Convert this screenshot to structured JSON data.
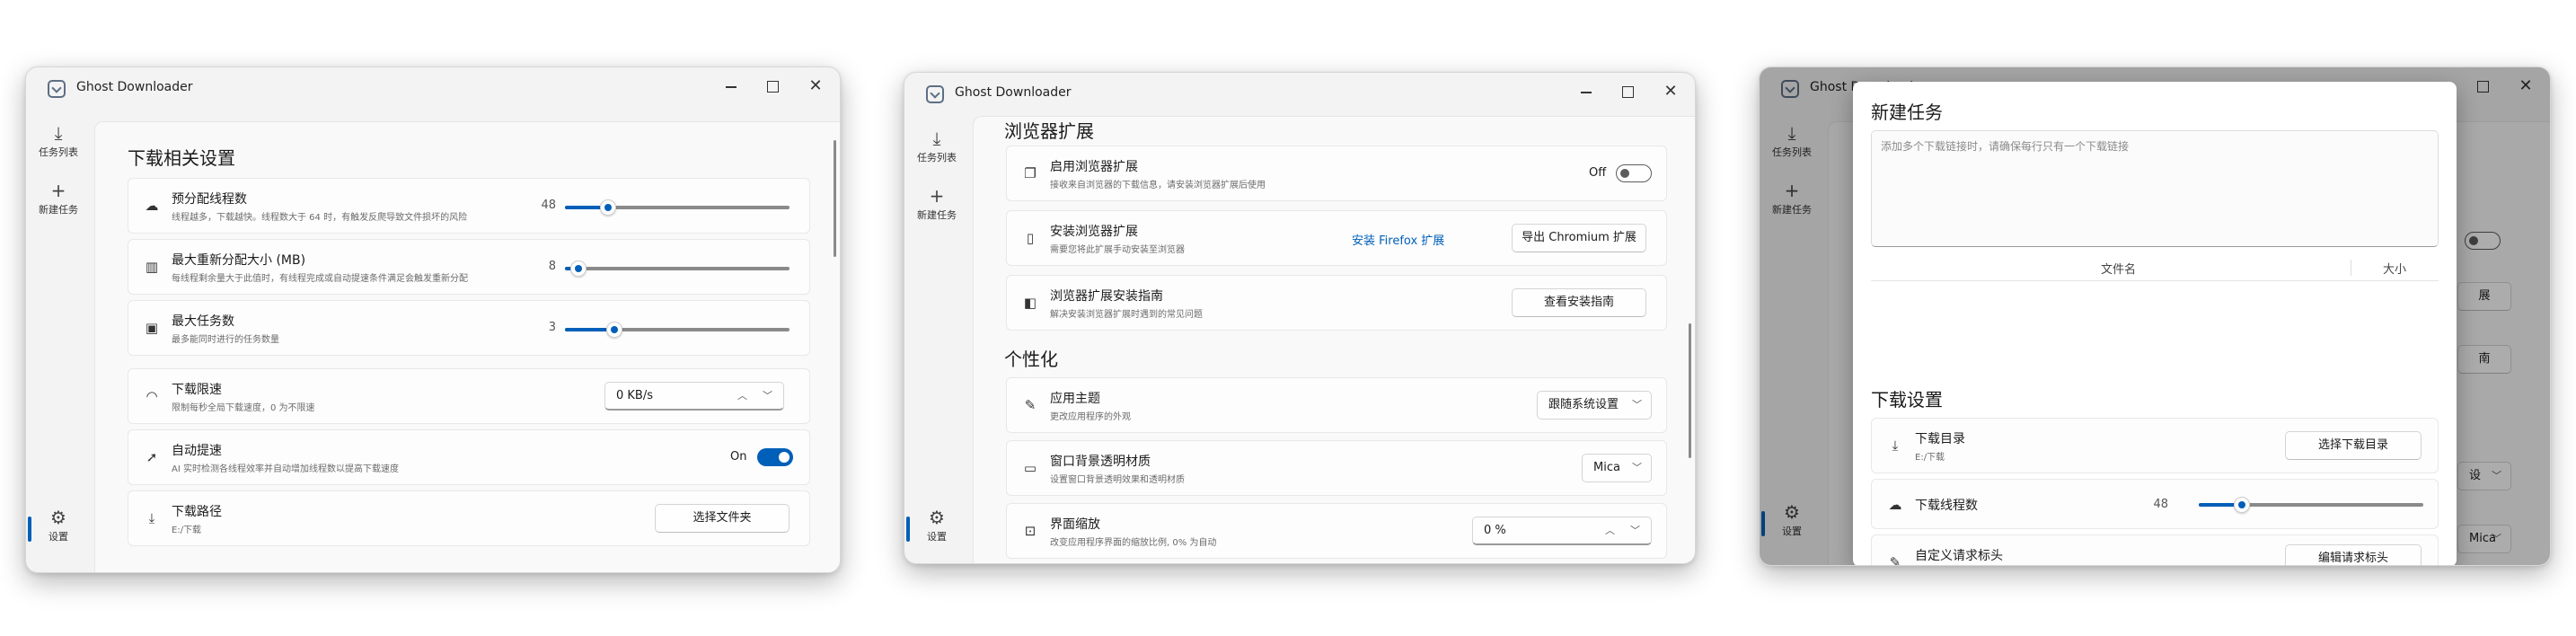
{
  "app_title": "Ghost Downloader",
  "nav": {
    "task_list": "任务列表",
    "new_task": "新建任务",
    "settings": "设置"
  },
  "window1": {
    "section_title": "下载相关设置",
    "preallocate": {
      "title": "预分配线程数",
      "subtitle": "线程越多，下载越快。线程数大于 64 时，有触发反爬导致文件损坏的风险",
      "value": "48",
      "level": 0.19
    },
    "max_realloc": {
      "title": "最大重新分配大小 (MB)",
      "subtitle": "每线程剩余量大于此值时，有线程完成或自动提速条件满足会触发重新分配",
      "value": "8",
      "level": 0.06
    },
    "max_tasks": {
      "title": "最大任务数",
      "subtitle": "最多能同时进行的任务数量",
      "value": "3",
      "level": 0.22
    },
    "speed_limit": {
      "title": "下载限速",
      "subtitle": "限制每秒全局下载速度，0 为不限速",
      "value": "0 KB/s"
    },
    "auto_speedup": {
      "title": "自动提速",
      "subtitle": "AI 实时检测各线程效率并自动增加线程数以提高下载速度",
      "state": "On"
    },
    "download_path": {
      "title": "下载路径",
      "subtitle": "E:/下载",
      "button": "选择文件夹"
    }
  },
  "window2": {
    "section_browser": "浏览器扩展",
    "enable_ext": {
      "title": "启用浏览器扩展",
      "subtitle": "接收来自浏览器的下载信息，请安装浏览器扩展后使用",
      "state": "Off"
    },
    "install_ext": {
      "title": "安装浏览器扩展",
      "subtitle": "需要您将此扩展手动安装至浏览器",
      "link": "安装 Firefox 扩展",
      "button": "导出 Chromium 扩展"
    },
    "install_guide": {
      "title": "浏览器扩展安装指南",
      "subtitle": "解决安装浏览器扩展时遇到的常见问题",
      "button": "查看安装指南"
    },
    "section_personal": "个性化",
    "theme": {
      "title": "应用主题",
      "subtitle": "更改应用程序的外观",
      "value": "跟随系统设置"
    },
    "backdrop": {
      "title": "窗口背景透明材质",
      "subtitle": "设置窗口背景透明效果和透明材质",
      "value": "Mica"
    },
    "scale": {
      "title": "界面缩放",
      "subtitle": "改变应用程序界面的缩放比例, 0% 为自动",
      "value": "0 %"
    }
  },
  "window3": {
    "dialog_title": "新建任务",
    "url_placeholder": "添加多个下载链接时，请确保每行只有一个下载链接",
    "col_filename": "文件名",
    "col_size": "大小",
    "section_download": "下载设置",
    "download_dir": {
      "title": "下载目录",
      "subtitle": "E:/下载",
      "button": "选择下载目录"
    },
    "threads": {
      "title": "下载线程数",
      "value": "48",
      "level": 0.19
    },
    "headers": {
      "title": "自定义请求标头",
      "button": "编辑请求标头"
    },
    "bg_fragments": [
      "展",
      "南",
      "设",
      "Mica"
    ]
  },
  "colors": {
    "accent": "#005fb8",
    "window_bg": "#f3f3f3",
    "card_bg": "#fdfdfd"
  }
}
